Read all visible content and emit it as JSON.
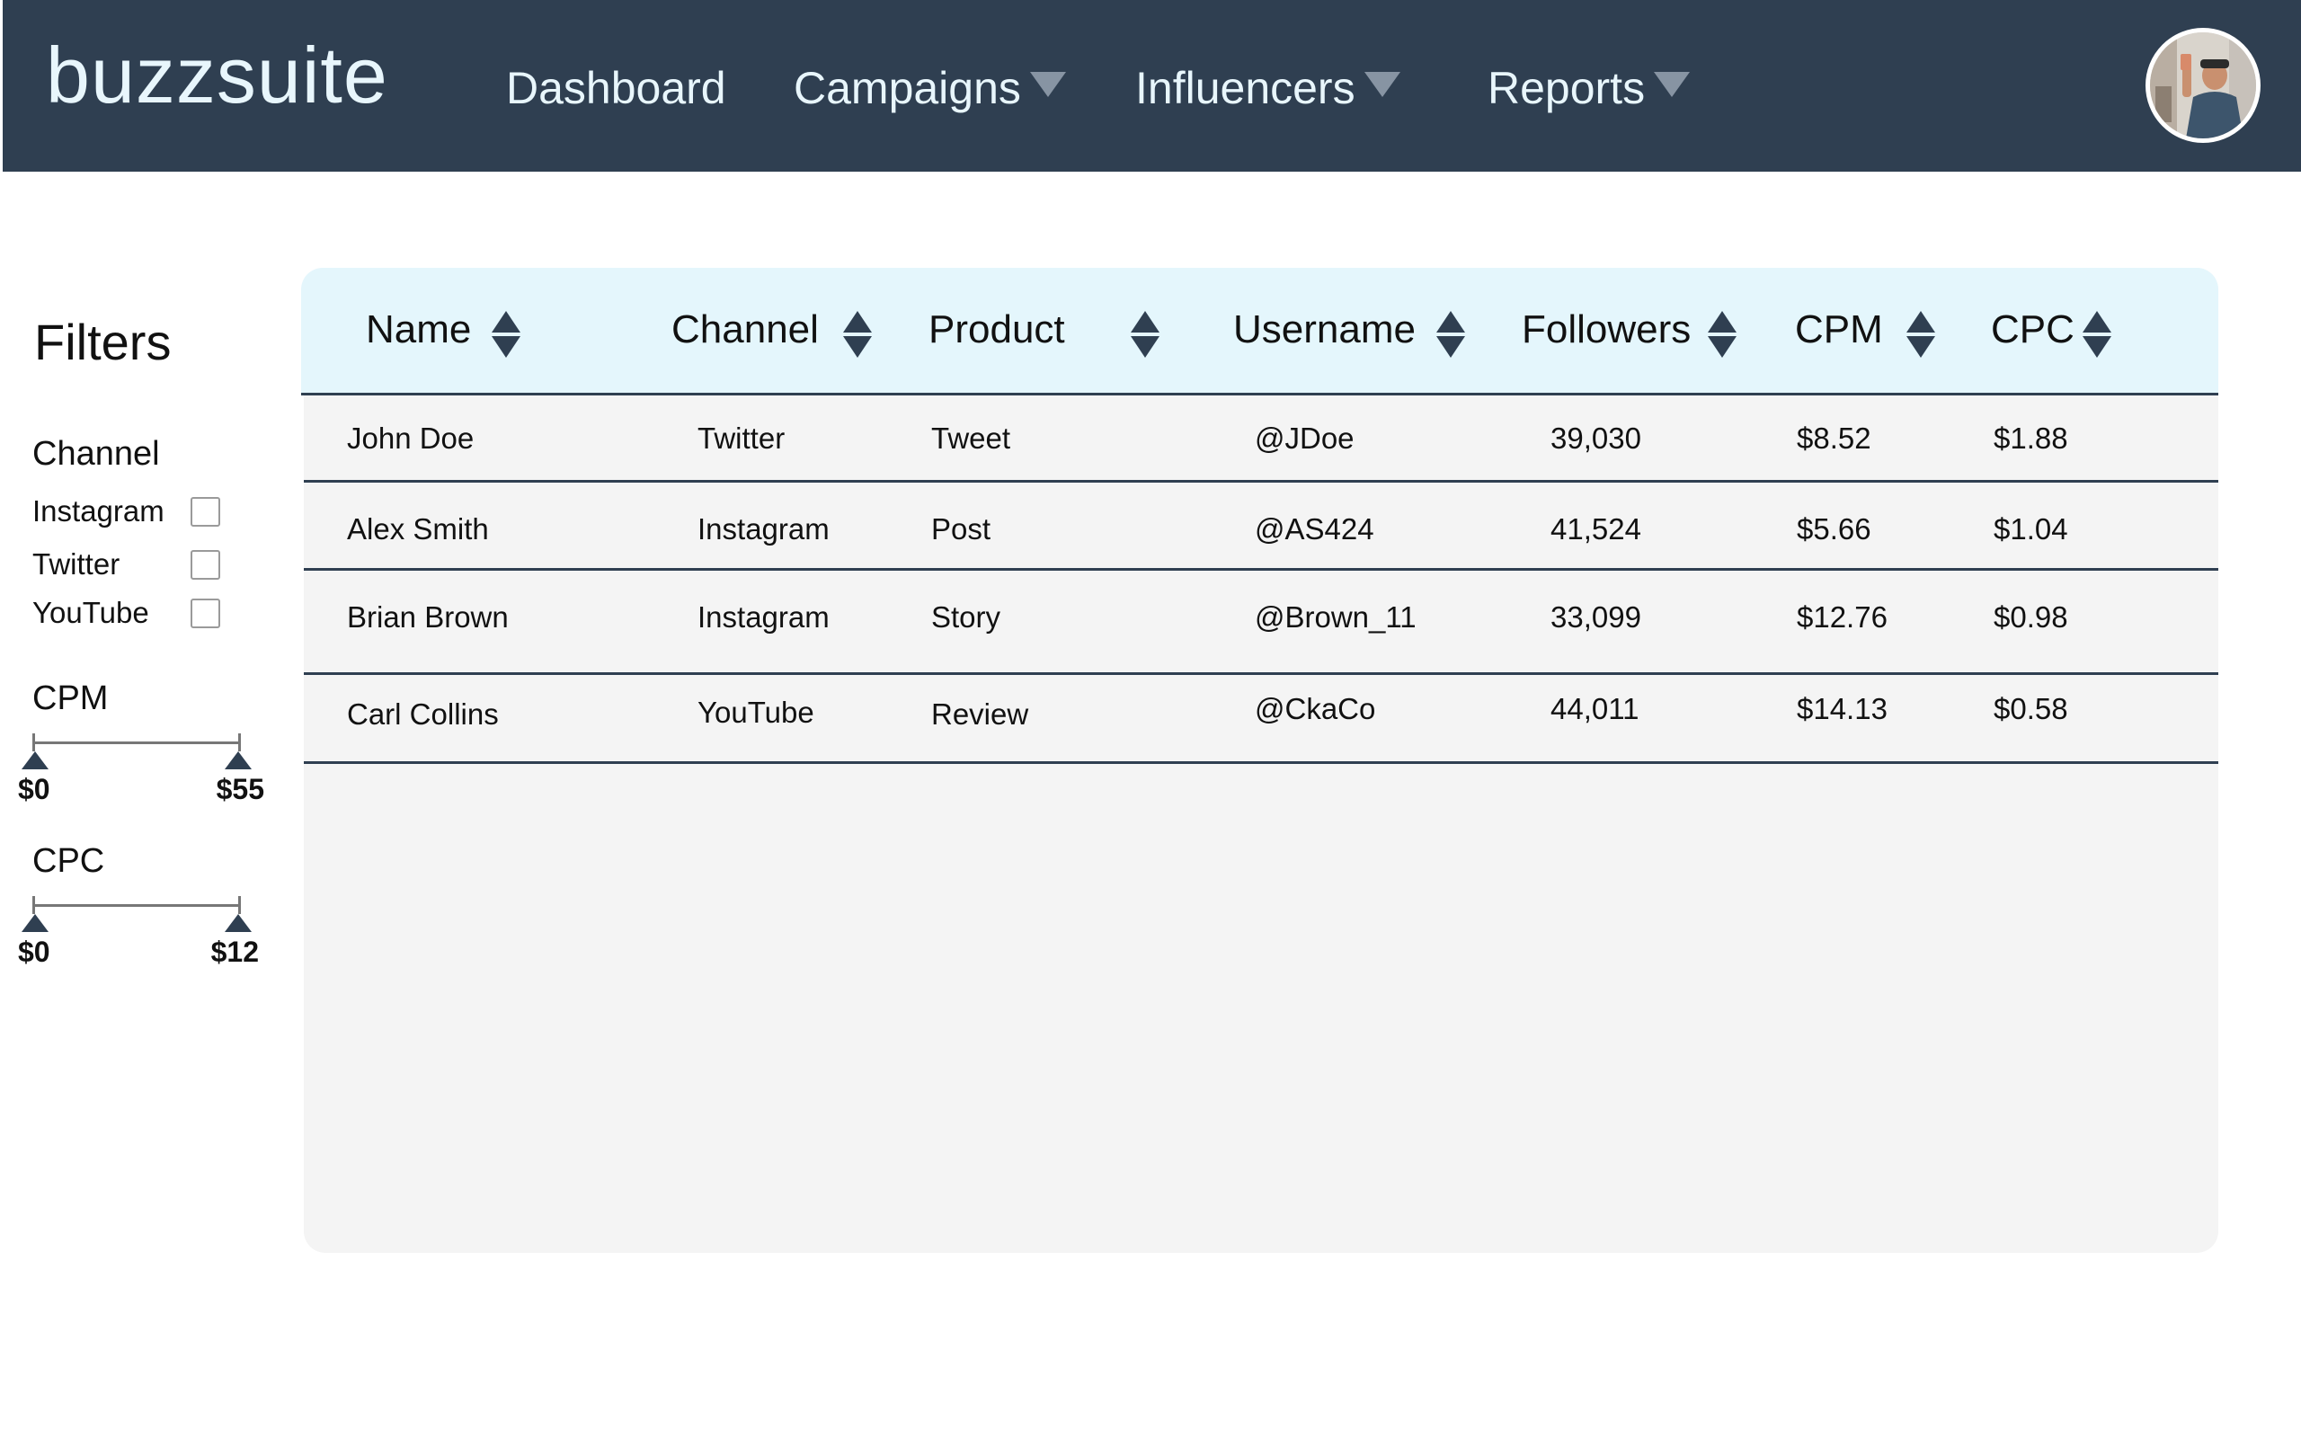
{
  "brand": "buzzsuite",
  "nav": {
    "items": [
      {
        "label": "Dashboard"
      },
      {
        "label": "Campaigns"
      },
      {
        "label": "Influencers"
      },
      {
        "label": "Reports"
      }
    ]
  },
  "filters": {
    "title": "Filters",
    "channel": {
      "heading": "Channel",
      "options": [
        {
          "label": "Instagram",
          "checked": false
        },
        {
          "label": "Twitter",
          "checked": false
        },
        {
          "label": "YouTube",
          "checked": false
        }
      ]
    },
    "cpm": {
      "heading": "CPM",
      "min_label": "$0",
      "max_label": "$55"
    },
    "cpc": {
      "heading": "CPC",
      "min_label": "$0",
      "max_label": "$12"
    }
  },
  "table": {
    "columns": [
      "Name",
      "Channel",
      "Product",
      "Username",
      "Followers",
      "CPM",
      "CPC"
    ],
    "rows": [
      [
        "John Doe",
        "Twitter",
        "Tweet",
        "@JDoe",
        "39,030",
        "$8.52",
        "$1.88"
      ],
      [
        "Alex Smith",
        "Instagram",
        "Post",
        "@AS424",
        "41,524",
        "$5.66",
        "$1.04"
      ],
      [
        "Brian Brown",
        "Instagram",
        "Story",
        "@Brown_11",
        "33,099",
        "$12.76",
        "$0.98"
      ],
      [
        "Carl Collins",
        "YouTube",
        "Review",
        "@CkaCo",
        "44,011",
        "$14.13",
        "$0.58"
      ]
    ]
  },
  "colors": {
    "nav_bg": "#2f3f51",
    "nav_text": "#e8f6fc",
    "table_header_bg": "#e4f6fc",
    "table_body_bg": "#f4f4f4",
    "accent": "#2f3f51"
  }
}
